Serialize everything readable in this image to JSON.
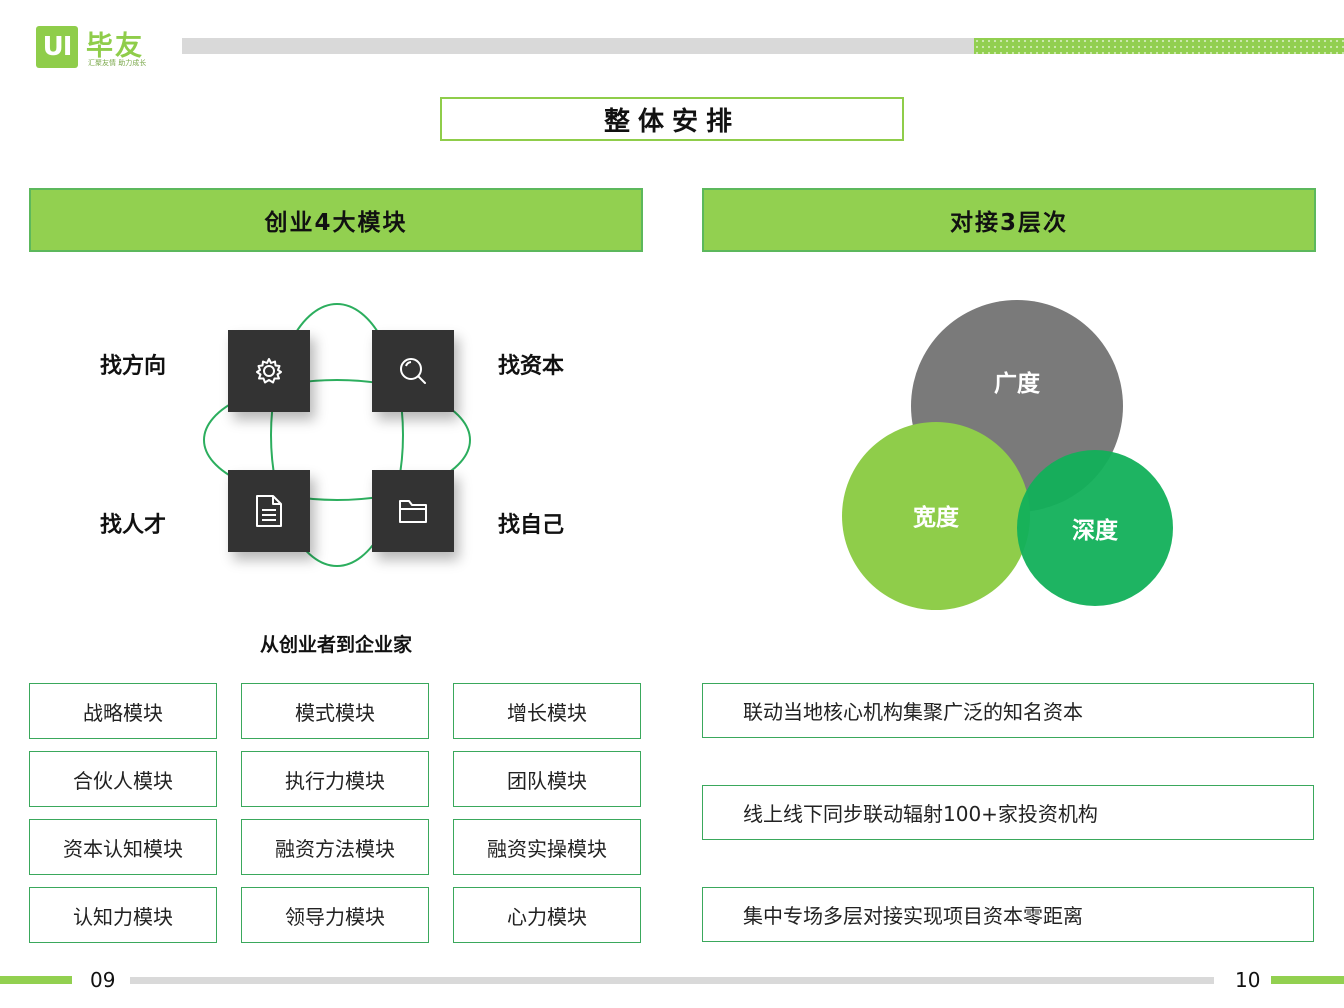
{
  "header": {
    "logo_mark": "UI",
    "logo_name": "毕友",
    "logo_tagline": "汇聚友情  助力成长",
    "title": "整体安排"
  },
  "left": {
    "section_title": "创业4大模块",
    "quadrants": [
      {
        "label": "找方向",
        "icon": "gear-icon"
      },
      {
        "label": "找资本",
        "icon": "search-icon"
      },
      {
        "label": "找人才",
        "icon": "document-icon"
      },
      {
        "label": "找自己",
        "icon": "folder-icon"
      }
    ],
    "subtitle": "从创业者到企业家",
    "modules": [
      [
        "战略模块",
        "模式模块",
        "增长模块"
      ],
      [
        "合伙人模块",
        "执行力模块",
        "团队模块"
      ],
      [
        "资本认知模块",
        "融资方法模块",
        "融资实操模块"
      ],
      [
        "认知力模块",
        "领导力模块",
        "心力模块"
      ]
    ]
  },
  "right": {
    "section_title": "对接3层次",
    "circles": [
      {
        "label": "广度",
        "color": "#7a7a7a"
      },
      {
        "label": "宽度",
        "color": "#8fcd4a"
      },
      {
        "label": "深度",
        "color": "#12b05a"
      }
    ],
    "items": [
      "联动当地核心机构集聚广泛的知名资本",
      "线上线下同步联动辐射100+家投资机构",
      "集中专场多层对接实现项目资本零距离"
    ]
  },
  "footer": {
    "page_left": "09",
    "page_right": "10"
  },
  "colors": {
    "brand_green": "#92d050",
    "border_green": "#3aa85c",
    "tile_dark": "#333333",
    "gray_bar": "#d9d9d9"
  }
}
